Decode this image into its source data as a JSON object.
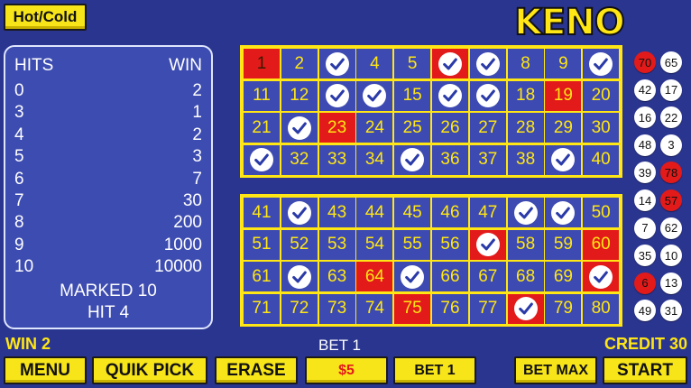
{
  "top": {
    "hotcold_label": "Hot/Cold",
    "logo": "KENO"
  },
  "paytable": {
    "header_hits": "HITS",
    "header_win": "WIN",
    "rows": [
      {
        "hits": "0",
        "win": "2"
      },
      {
        "hits": "3",
        "win": "1"
      },
      {
        "hits": "4",
        "win": "2"
      },
      {
        "hits": "5",
        "win": "3"
      },
      {
        "hits": "6",
        "win": "7"
      },
      {
        "hits": "7",
        "win": "30"
      },
      {
        "hits": "8",
        "win": "200"
      },
      {
        "hits": "9",
        "win": "1000"
      },
      {
        "hits": "10",
        "win": "10000"
      }
    ],
    "marked": "MARKED 10",
    "hit": "HIT 4"
  },
  "boards": [
    {
      "cells": [
        {
          "label": "1",
          "state": "red"
        },
        {
          "label": "2",
          "state": "normal"
        },
        {
          "label": "",
          "state": "check"
        },
        {
          "label": "4",
          "state": "normal"
        },
        {
          "label": "5",
          "state": "normal"
        },
        {
          "label": "",
          "state": "check-red"
        },
        {
          "label": "",
          "state": "check"
        },
        {
          "label": "8",
          "state": "normal"
        },
        {
          "label": "9",
          "state": "normal"
        },
        {
          "label": "",
          "state": "check"
        },
        {
          "label": "11",
          "state": "normal"
        },
        {
          "label": "12",
          "state": "normal"
        },
        {
          "label": "",
          "state": "check"
        },
        {
          "label": "",
          "state": "check"
        },
        {
          "label": "15",
          "state": "normal"
        },
        {
          "label": "",
          "state": "check"
        },
        {
          "label": "",
          "state": "check"
        },
        {
          "label": "18",
          "state": "normal"
        },
        {
          "label": "19",
          "state": "red"
        },
        {
          "label": "20",
          "state": "normal"
        },
        {
          "label": "21",
          "state": "normal"
        },
        {
          "label": "",
          "state": "check"
        },
        {
          "label": "23",
          "state": "red"
        },
        {
          "label": "24",
          "state": "normal"
        },
        {
          "label": "25",
          "state": "normal"
        },
        {
          "label": "26",
          "state": "normal"
        },
        {
          "label": "27",
          "state": "normal"
        },
        {
          "label": "28",
          "state": "normal"
        },
        {
          "label": "29",
          "state": "normal"
        },
        {
          "label": "30",
          "state": "normal"
        },
        {
          "label": "",
          "state": "check"
        },
        {
          "label": "32",
          "state": "normal"
        },
        {
          "label": "33",
          "state": "normal"
        },
        {
          "label": "34",
          "state": "normal"
        },
        {
          "label": "",
          "state": "check"
        },
        {
          "label": "36",
          "state": "normal"
        },
        {
          "label": "37",
          "state": "normal"
        },
        {
          "label": "38",
          "state": "normal"
        },
        {
          "label": "",
          "state": "check"
        },
        {
          "label": "40",
          "state": "normal"
        }
      ]
    },
    {
      "cells": [
        {
          "label": "41",
          "state": "normal"
        },
        {
          "label": "",
          "state": "check"
        },
        {
          "label": "43",
          "state": "normal"
        },
        {
          "label": "44",
          "state": "normal"
        },
        {
          "label": "45",
          "state": "normal"
        },
        {
          "label": "46",
          "state": "normal"
        },
        {
          "label": "47",
          "state": "normal"
        },
        {
          "label": "",
          "state": "check"
        },
        {
          "label": "",
          "state": "check"
        },
        {
          "label": "50",
          "state": "normal"
        },
        {
          "label": "51",
          "state": "normal"
        },
        {
          "label": "52",
          "state": "normal"
        },
        {
          "label": "53",
          "state": "normal"
        },
        {
          "label": "54",
          "state": "normal"
        },
        {
          "label": "55",
          "state": "normal"
        },
        {
          "label": "56",
          "state": "normal"
        },
        {
          "label": "",
          "state": "check-red"
        },
        {
          "label": "58",
          "state": "normal"
        },
        {
          "label": "59",
          "state": "normal"
        },
        {
          "label": "60",
          "state": "red"
        },
        {
          "label": "61",
          "state": "normal"
        },
        {
          "label": "",
          "state": "check"
        },
        {
          "label": "63",
          "state": "normal"
        },
        {
          "label": "64",
          "state": "red"
        },
        {
          "label": "",
          "state": "check"
        },
        {
          "label": "66",
          "state": "normal"
        },
        {
          "label": "67",
          "state": "normal"
        },
        {
          "label": "68",
          "state": "normal"
        },
        {
          "label": "69",
          "state": "normal"
        },
        {
          "label": "",
          "state": "check-red"
        },
        {
          "label": "71",
          "state": "normal"
        },
        {
          "label": "72",
          "state": "normal"
        },
        {
          "label": "73",
          "state": "normal"
        },
        {
          "label": "74",
          "state": "normal"
        },
        {
          "label": "75",
          "state": "red"
        },
        {
          "label": "76",
          "state": "normal"
        },
        {
          "label": "77",
          "state": "normal"
        },
        {
          "label": "",
          "state": "check-red"
        },
        {
          "label": "79",
          "state": "normal"
        },
        {
          "label": "80",
          "state": "normal"
        }
      ]
    }
  ],
  "drawn_balls": [
    {
      "number": "70",
      "color": "red"
    },
    {
      "number": "65",
      "color": "white"
    },
    {
      "number": "42",
      "color": "white"
    },
    {
      "number": "17",
      "color": "white"
    },
    {
      "number": "16",
      "color": "white"
    },
    {
      "number": "22",
      "color": "white"
    },
    {
      "number": "48",
      "color": "white"
    },
    {
      "number": "3",
      "color": "white"
    },
    {
      "number": "39",
      "color": "white"
    },
    {
      "number": "78",
      "color": "red"
    },
    {
      "number": "14",
      "color": "white"
    },
    {
      "number": "57",
      "color": "red"
    },
    {
      "number": "7",
      "color": "white"
    },
    {
      "number": "62",
      "color": "white"
    },
    {
      "number": "35",
      "color": "white"
    },
    {
      "number": "10",
      "color": "white"
    },
    {
      "number": "6",
      "color": "red"
    },
    {
      "number": "13",
      "color": "white"
    },
    {
      "number": "49",
      "color": "white"
    },
    {
      "number": "31",
      "color": "white"
    }
  ],
  "status": {
    "win": "WIN 2",
    "bet": "BET 1",
    "credit": "CREDIT 30"
  },
  "buttons": {
    "menu": "MENU",
    "quik_pick": "QUIK PICK",
    "erase": "ERASE",
    "amount": "$5",
    "bet_one": "BET 1",
    "bet_max": "BET MAX",
    "start": "START"
  },
  "colors": {
    "background": "#2a3590",
    "cell": "#3d4ab1",
    "accent_yellow": "#ffe614",
    "hit_red": "#e31a1a",
    "check_blue": "#2a3aa8"
  }
}
